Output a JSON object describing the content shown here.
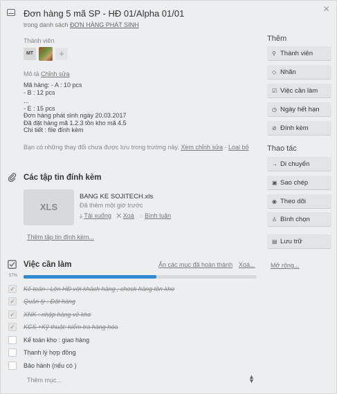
{
  "card": {
    "title": "Đơn hàng 5 mã SP - HĐ 01/Alpha 01/01",
    "in_list_prefix": "trong danh sách",
    "list_name": "ĐƠN HÀNG PHÁT SINH",
    "close_glyph": "×"
  },
  "members": {
    "label": "Thành viên",
    "initials": "MT",
    "add_glyph": "+"
  },
  "description": {
    "label": "Mô tả",
    "edit_label": "Chỉnh sửa",
    "lines": [
      "Mã hàng: - A : 10 pcs",
      "- B : 12 pcs",
      "...",
      "- E : 15 pcs",
      "Đơn hàng phát sinh ngày 20.03.2017",
      "Đã đặt hàng mã 1.2.3 tồn kho mã 4.5",
      "Chi tiết : file đính kèm"
    ],
    "unsaved_text": "Bạn có những thay đổi chưa được lưu trong trường này.",
    "view_edit": "Xem chỉnh sửa",
    "dash": "-",
    "discard": "Loại bỏ"
  },
  "attachments": {
    "title": "Các tập tin đính kèm",
    "file_thumb": "XLS",
    "file_name": "BANG KE SOJITECH.xls",
    "added": "Đã thêm một giờ trước",
    "download": "Tải xuống",
    "delete": "Xoá",
    "comment": "Bình luận",
    "add_attachment": "Thêm tập tin đính kèm..."
  },
  "checklist": {
    "title": "Việc cần làm",
    "hide_done": "Ẩn các mục đã hoàn thành",
    "delete": "Xoá...",
    "progress_label": "57%",
    "progress": 0.57,
    "items": [
      {
        "text": "Kế toán : Lên HĐ với khách hàng , check hàng tồn kho",
        "done": true
      },
      {
        "text": "Quản lý : Đặt hàng",
        "done": true
      },
      {
        "text": "XNK : nhập hàng về kho",
        "done": true
      },
      {
        "text": "KCS +Kỹ thuật: kiểm tra hàng hóa",
        "done": true
      },
      {
        "text": "Kế toán kho : giao hàng",
        "done": false
      },
      {
        "text": "Thanh lý hợp đồng",
        "done": false
      },
      {
        "text": "Bảo hành (nếu có )",
        "done": false
      }
    ],
    "add_item": "Thêm mục...",
    "check_glyph": "✓"
  },
  "sidebar": {
    "add_heading": "Thêm",
    "add_buttons": [
      {
        "label": "Thành viên",
        "icon": "person-icon",
        "glyph": "⚲"
      },
      {
        "label": "Nhãn",
        "icon": "tag-icon",
        "glyph": "◇"
      },
      {
        "label": "Việc cần làm",
        "icon": "checklist-icon",
        "glyph": "☑"
      },
      {
        "label": "Ngày hết hạn",
        "icon": "clock-icon",
        "glyph": "◷"
      },
      {
        "label": "Đính kèm",
        "icon": "paperclip-icon",
        "glyph": "⊘"
      }
    ],
    "actions_heading": "Thao tác",
    "action_buttons": [
      {
        "label": "Di chuyển",
        "icon": "arrow-right-icon",
        "glyph": "→"
      },
      {
        "label": "Sao chép",
        "icon": "copy-icon",
        "glyph": "▣"
      },
      {
        "label": "Theo dõi",
        "icon": "eye-icon",
        "glyph": "◉"
      },
      {
        "label": "Bình chọn",
        "icon": "thumbs-up-icon",
        "glyph": "♙"
      },
      {
        "label": "Lưu trữ",
        "icon": "archive-icon",
        "glyph": "▤"
      }
    ],
    "more": "Mở rộng..."
  }
}
